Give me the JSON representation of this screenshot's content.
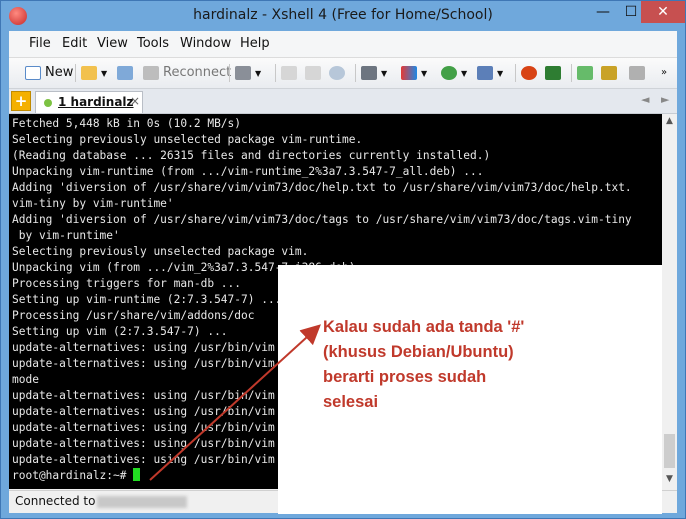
{
  "window": {
    "title": "hardinalz - Xshell 4 (Free for Home/School)",
    "min_glyph": "—",
    "max_glyph": "☐",
    "close_glyph": "✕"
  },
  "menu": [
    "File",
    "Edit",
    "View",
    "Tools",
    "Window",
    "Help"
  ],
  "toolbar": {
    "new_label": "New",
    "reconnect_label": "Reconnect"
  },
  "tabs": {
    "add_glyph": "+",
    "items": [
      {
        "label": "1 hardinalz",
        "close_glyph": "×"
      }
    ],
    "prev_glyph": "◄",
    "next_glyph": "►"
  },
  "terminal": {
    "lines": [
      "Fetched 5,448 kB in 0s (10.2 MB/s)",
      "Selecting previously unselected package vim-runtime.",
      "(Reading database ... 26315 files and directories currently installed.)",
      "Unpacking vim-runtime (from .../vim-runtime_2%3a7.3.547-7_all.deb) ...",
      "Adding 'diversion of /usr/share/vim/vim73/doc/help.txt to /usr/share/vim/vim73/doc/help.txt.",
      "vim-tiny by vim-runtime'",
      "Adding 'diversion of /usr/share/vim/vim73/doc/tags to /usr/share/vim/vim73/doc/tags.vim-tiny",
      " by vim-runtime'",
      "Selecting previously unselected package vim.",
      "Unpacking vim (from .../vim_2%3a7.3.547-7_i386.deb) ...",
      "Processing triggers for man-db ...",
      "Setting up vim-runtime (2:7.3.547-7) ...",
      "Processing /usr/share/vim/addons/doc",
      "Setting up vim (2:7.3.547-7) ...",
      "update-alternatives: using /usr/bin/vim",
      "update-alternatives: using /usr/bin/vim",
      "mode",
      "update-alternatives: using /usr/bin/vim",
      "update-alternatives: using /usr/bin/vim",
      "update-alternatives: using /usr/bin/vim",
      "update-alternatives: using /usr/bin/vim",
      "update-alternatives: using /usr/bin/vim"
    ],
    "prompt": "root@hardinalz:~# "
  },
  "scrollbar": {
    "up_glyph": "▲",
    "down_glyph": "▼"
  },
  "status": {
    "text": "Connected to"
  },
  "annotation": {
    "text": "Kalau sudah ada tanda '#'\n(khusus Debian/Ubuntu)\nberarti proses sudah\nselesai",
    "color": "#c0392b"
  },
  "colors": {
    "titlebar": "#6fa8dc",
    "close_button": "#c75050",
    "terminal_bg": "#000000",
    "terminal_fg": "#e8e8e8",
    "cursor": "#22dd22"
  }
}
